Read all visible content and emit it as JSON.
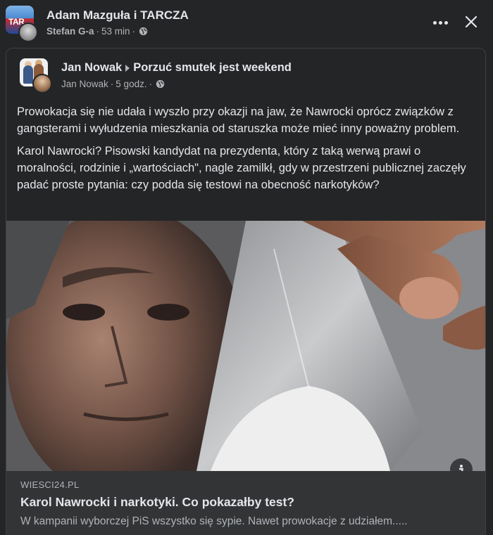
{
  "outer_post": {
    "title": "Adam Mazguła i TARCZA",
    "group_avatar_text": "TAR",
    "author": "Stefan G-a",
    "time": "53 min",
    "separator": "·"
  },
  "shared_post": {
    "page_name": "Jan Nowak",
    "group_name": "Porzuć smutek jest weekend",
    "author": "Jan Nowak",
    "time": "5 godz.",
    "separator": "·",
    "paragraphs": [
      "Prowokacja się nie udała i wyszło przy okazji na jaw, że Nawrocki oprócz związków z gangsterami i wyłudzenia mieszkania od staruszka może mieć inny poważny problem.",
      "Karol Nawrocki? Pisowski kandydat na prezydenta, który z taką werwą prawi o moralności, rodzinie i „wartościach\", nagle zamilkł, gdy w przestrzeni publicznej zaczęły padać proste pytania: czy podda się testowi na obecność narkotyków?"
    ]
  },
  "link_preview": {
    "domain": "WIESCI24.PL",
    "title": "Karol Nawrocki i narkotyki. Co pokazałby test?",
    "description": "W kampanii wyborczej PiS wszystko się sypie. Nawet prowokacje z udziałem....."
  },
  "icons": {
    "more": "more-dots-icon",
    "close": "close-icon",
    "audience": "globe-icon",
    "info": "info-icon"
  },
  "colors": {
    "background": "#242526",
    "text_primary": "#e4e6eb",
    "text_secondary": "#b0b3b8",
    "link_footer_bg": "#323436",
    "border": "#3e4042"
  }
}
